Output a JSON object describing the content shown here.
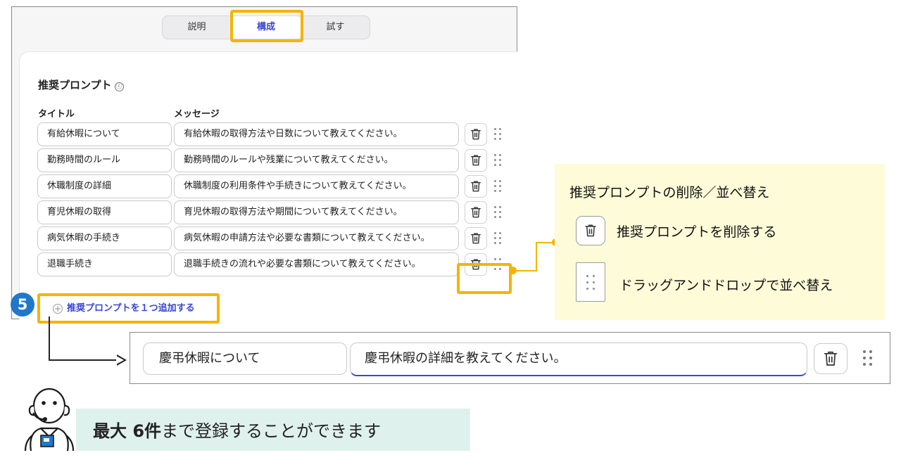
{
  "tabs": [
    {
      "label": "説明"
    },
    {
      "label": "構成"
    },
    {
      "label": "試す"
    }
  ],
  "section": {
    "title": "推奨プロンプト",
    "info_icon": "ⓘ",
    "column_title": "タイトル",
    "column_message": "メッセージ"
  },
  "prompts": [
    {
      "title": "有給休暇について",
      "message": "有給休暇の取得方法や日数について教えてください。"
    },
    {
      "title": "勤務時間のルール",
      "message": "勤務時間のルールや残業について教えてください。"
    },
    {
      "title": "休職制度の詳細",
      "message": "休職制度の利用条件や手続きについて教えてください。"
    },
    {
      "title": "育児休暇の取得",
      "message": "育児休暇の取得方法や期間について教えてください。"
    },
    {
      "title": "病気休暇の手続き",
      "message": "病気休暇の申請方法や必要な書類について教えてください。"
    },
    {
      "title": "退職手続き",
      "message": "退職手続きの流れや必要な書類について教えてください。"
    }
  ],
  "add_link": "推奨プロンプトを１つ追加する",
  "step_badge": "5",
  "callout": {
    "title": "推奨プロンプトの削除／並べ替え",
    "delete_label": "推奨プロンプトを削除する",
    "reorder_label": "ドラッグアンドドロップで並べ替え"
  },
  "example": {
    "title": "慶弔休暇について",
    "message": "慶弔休暇の詳細を教えてください。"
  },
  "note": {
    "strong": "最大 6件",
    "rest": "まで登録することができます"
  },
  "colors": {
    "accent": "#3945d6",
    "highlight": "#f5b400",
    "badge": "#1f78c9",
    "callout_bg": "#fefcd8",
    "note_bg": "#dff1ec"
  },
  "icons": [
    "trash-icon",
    "drag-handle-icon",
    "info-icon",
    "plus-circle-icon",
    "support-agent-icon"
  ]
}
